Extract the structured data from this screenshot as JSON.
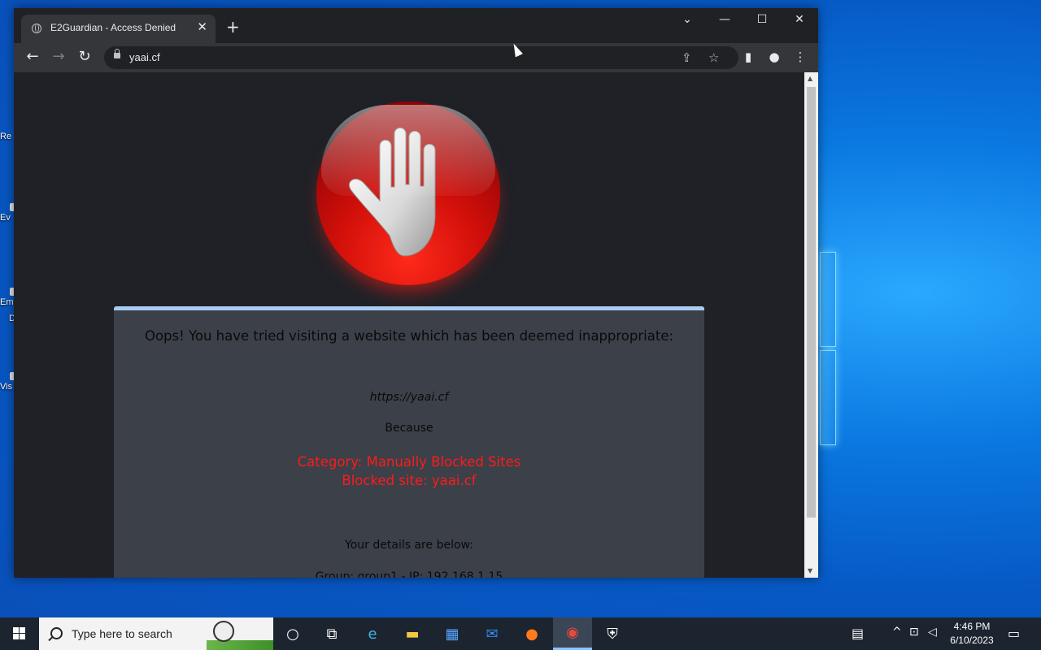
{
  "desktop": {
    "icons": [
      {
        "label": "Re"
      },
      {
        "label": "Ev"
      },
      {
        "label": "Em"
      },
      {
        "label": "D"
      },
      {
        "label": "Vis"
      }
    ]
  },
  "browser": {
    "tab": {
      "title": "E2Guardian - Access Denied",
      "close_glyph": "✕"
    },
    "new_tab_glyph": "+",
    "window_controls": {
      "tab_search": "⌄",
      "minimize": "—",
      "maximize": "☐",
      "close": "✕"
    },
    "nav": {
      "back": "←",
      "forward": "→",
      "reload": "↻"
    },
    "address": {
      "url": "yaai.cf"
    },
    "toolbar_icons": {
      "share": "⇪",
      "bookmark": "☆",
      "side_panel": "▮",
      "profile": "●",
      "menu": "⋮"
    }
  },
  "page": {
    "headline": "Oops! You have tried visiting a website which has been deemed inappropriate:",
    "blocked_url": "https://yaai.cf",
    "because_label": "Because",
    "reason_category": "Category: Manually Blocked Sites",
    "reason_site": "Blocked site: yaai.cf",
    "details_title": "Your details are below:",
    "details_line": "Group: group1 - IP: 192.168.1.15",
    "stop_sign_color": "#d10f0a",
    "panel_color": "#3c4049",
    "panel_accent": "#a9cdf0",
    "reason_color": "#ff1a1a"
  },
  "taskbar": {
    "search_placeholder": "Type here to search",
    "apps": [
      {
        "name": "cortana-icon",
        "glyph": "○"
      },
      {
        "name": "task-view-icon",
        "glyph": "⧉"
      },
      {
        "name": "edge-icon",
        "glyph": "e"
      },
      {
        "name": "file-explorer-icon",
        "glyph": "▬"
      },
      {
        "name": "store-icon",
        "glyph": "▦"
      },
      {
        "name": "mail-icon",
        "glyph": "✉"
      },
      {
        "name": "firefox-icon",
        "glyph": "●"
      },
      {
        "name": "chrome-icon",
        "glyph": "◉"
      },
      {
        "name": "security-icon",
        "glyph": "⛨"
      }
    ],
    "tray": {
      "news": "▤",
      "chevron": "^",
      "network": "⊡",
      "volume": "◁"
    },
    "clock": {
      "time": "4:46 PM",
      "date": "6/10/2023"
    },
    "notifications": "▭"
  }
}
